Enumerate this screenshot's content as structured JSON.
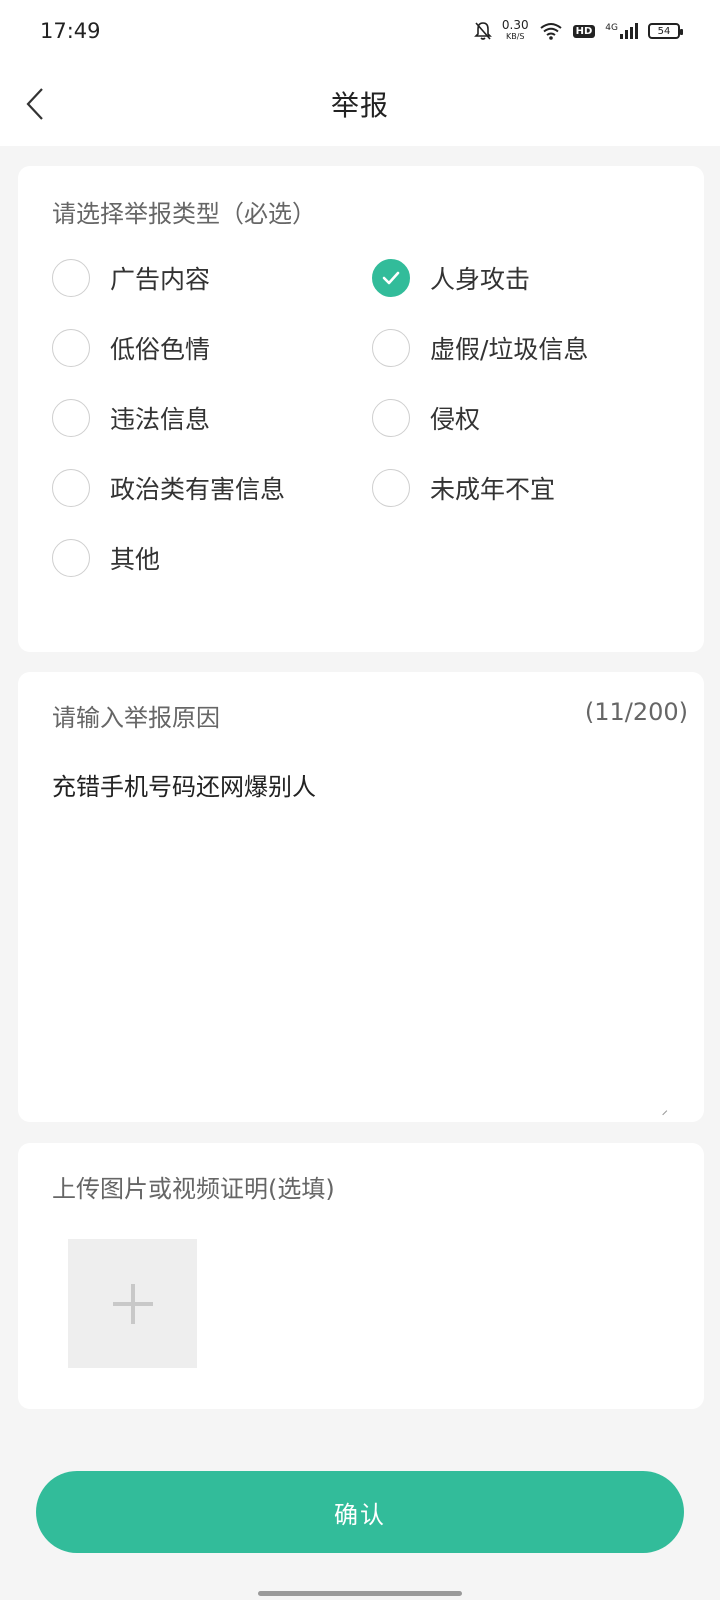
{
  "status_bar": {
    "time": "17:49",
    "speed_value": "0.30",
    "speed_unit": "KB/S",
    "hd_label": "HD",
    "network_label": "4G",
    "battery_level": "54",
    "icons": [
      "bell-off-icon",
      "wifi-icon",
      "signal-icon",
      "battery-icon"
    ]
  },
  "header": {
    "title": "举报",
    "back_icon": "chevron-left-icon"
  },
  "report_type": {
    "label": "请选择举报类型（必选）",
    "options": [
      {
        "label": "广告内容",
        "checked": false
      },
      {
        "label": "人身攻击",
        "checked": true
      },
      {
        "label": "低俗色情",
        "checked": false
      },
      {
        "label": "虚假/垃圾信息",
        "checked": false
      },
      {
        "label": "违法信息",
        "checked": false
      },
      {
        "label": "侵权",
        "checked": false
      },
      {
        "label": "政治类有害信息",
        "checked": false
      },
      {
        "label": "未成年不宜",
        "checked": false
      },
      {
        "label": "其他",
        "checked": false
      }
    ]
  },
  "reason": {
    "label": "请输入举报原因",
    "counter": "(11/200)",
    "value": "充错手机号码还网爆别人"
  },
  "upload": {
    "label": "上传图片或视频证明(选填)",
    "add_icon": "plus-icon"
  },
  "confirm_label": "确认",
  "colors": {
    "accent": "#32bc9a",
    "background": "#f5f5f5",
    "card": "#ffffff"
  }
}
